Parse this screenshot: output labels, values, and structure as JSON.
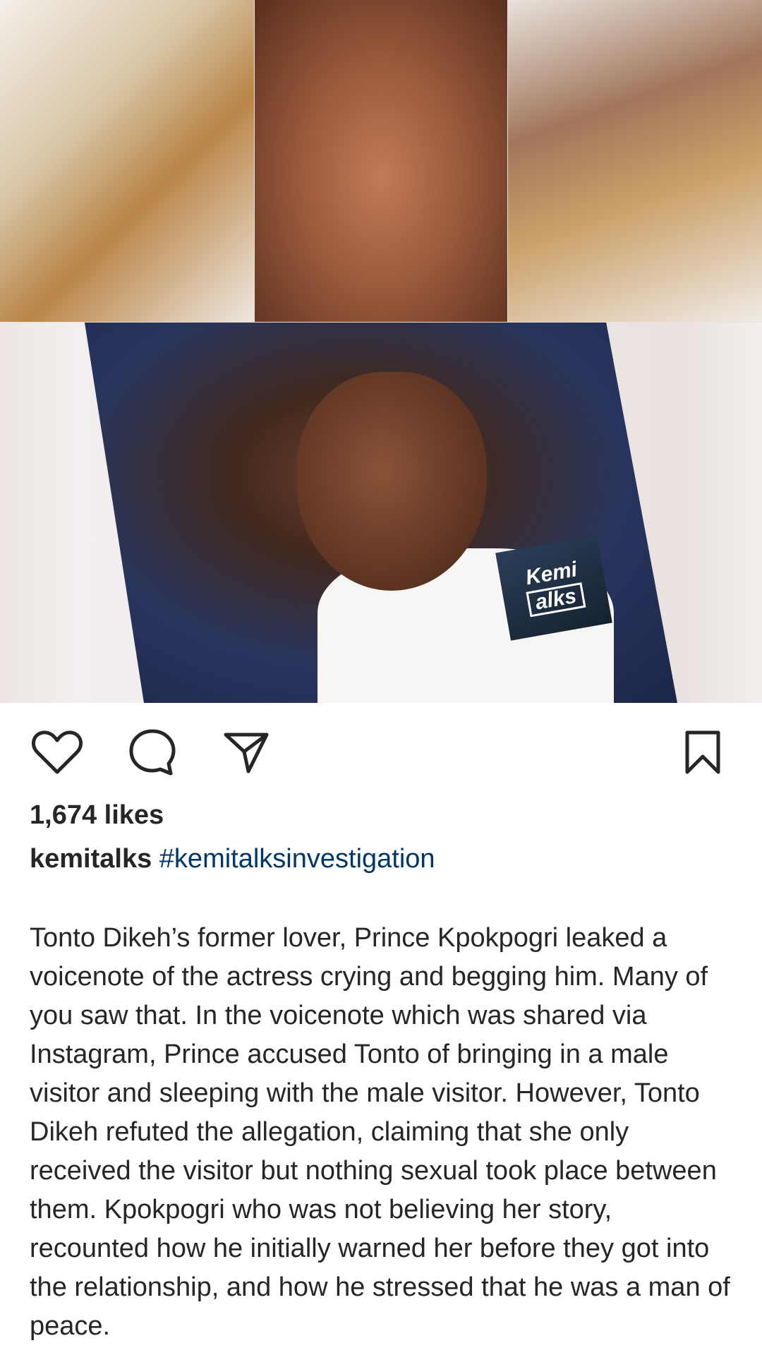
{
  "post": {
    "image": {
      "watermark_line1": "Kemi",
      "watermark_line2": "alks"
    },
    "likes": "1,674 likes",
    "username": "kemitalks",
    "hashtag": "#kemitalksinvestigation",
    "caption": "Tonto Dikeh’s former lover, Prince Kpokpogri leaked a voicenote of the actress crying and begging him. Many of you saw that. In the voicenote which was shared via Instagram, Prince accused Tonto of bringing in a male visitor and sleeping with the male visitor. However, Tonto Dikeh refuted the allegation, claiming that she only received the visitor but nothing sexual took place between them. Kpokpogri who was not believing her story, recounted how he initially warned her before they got into the relationship, and how he stressed that he was a man of peace."
  },
  "icons": {
    "like": "heart-icon",
    "comment": "comment-icon",
    "share": "send-icon",
    "save": "bookmark-icon"
  },
  "colors": {
    "text": "#262626",
    "hashtag": "#00376b"
  }
}
